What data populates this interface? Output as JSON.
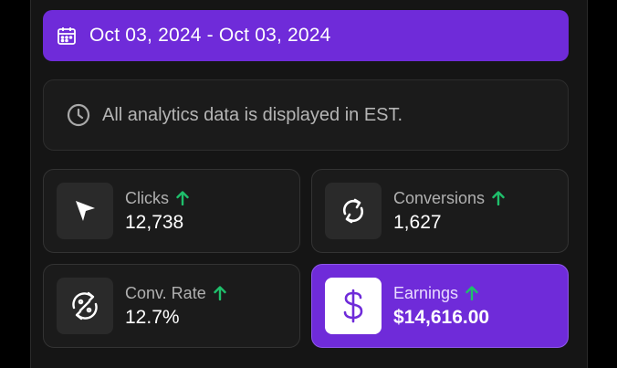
{
  "date_range": {
    "label": "Oct 03, 2024 - Oct 03, 2024",
    "icon": "calendar-icon"
  },
  "notice": {
    "text": "All analytics data is displayed in EST.",
    "icon": "clock-icon"
  },
  "metrics": [
    {
      "label": "Clicks",
      "value": "12,738",
      "trend": "up",
      "icon": "cursor-icon"
    },
    {
      "label": "Conversions",
      "value": "1,627",
      "trend": "up",
      "icon": "refresh-icon"
    },
    {
      "label": "Conv. Rate",
      "value": "12.7%",
      "trend": "up",
      "icon": "percent-cycle-icon"
    },
    {
      "label": "Earnings",
      "value": "$14,616.00",
      "trend": "up",
      "icon": "dollar-icon"
    }
  ],
  "colors": {
    "accent": "#6f2bd9",
    "trend_up": "#1fbf6b",
    "background": "#151515",
    "card": "#1b1b1b"
  }
}
